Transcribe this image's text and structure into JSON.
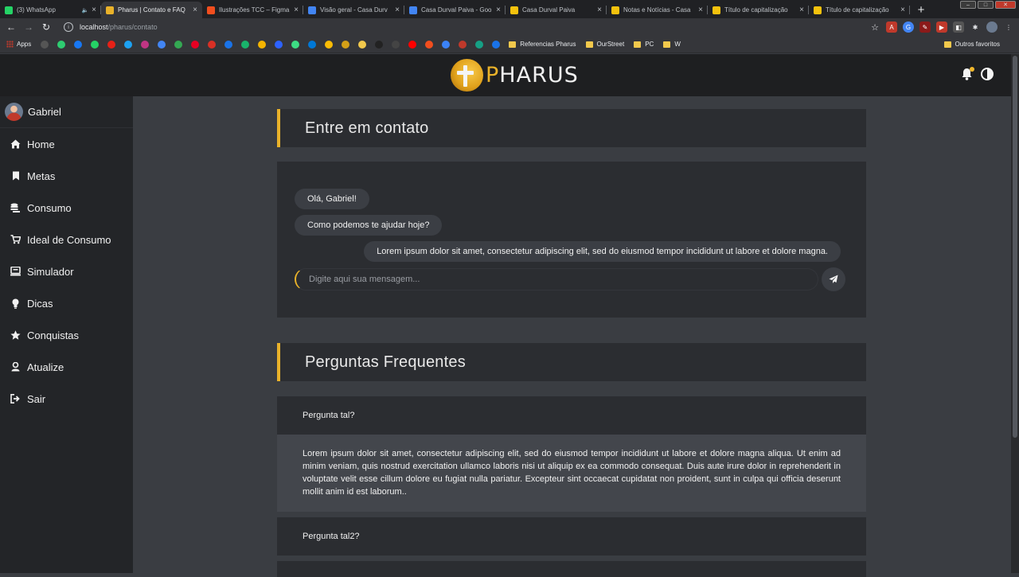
{
  "browser": {
    "tabs": [
      {
        "title": "(3) WhatsApp",
        "favicon_color": "#25d366",
        "favicon_glyph": "whatsapp-icon",
        "muted": true
      },
      {
        "title": "Pharus | Contato e FAQ",
        "favicon_color": "#e9b22a",
        "favicon_glyph": "pharus-icon",
        "active": true
      },
      {
        "title": "Ilustrações TCC – Figma",
        "favicon_color": "#f24e1e",
        "favicon_glyph": "figma-icon"
      },
      {
        "title": "Visão geral - Casa Durv",
        "favicon_color": "#4285f4",
        "favicon_glyph": "analytics-icon"
      },
      {
        "title": "Casa Durval Paiva - Goo",
        "favicon_color": "#4285f4",
        "favicon_glyph": "analytics-icon"
      },
      {
        "title": "Casa Durval Paiva",
        "favicon_color": "#f4c20d",
        "favicon_glyph": "site-icon"
      },
      {
        "title": "Notas e Notícias - Casa",
        "favicon_color": "#f4c20d",
        "favicon_glyph": "site-icon"
      },
      {
        "title": "Título de capitalização",
        "favicon_color": "#f4c20d",
        "favicon_glyph": "site-icon"
      },
      {
        "title": "Título de capitalização",
        "favicon_color": "#f4c20d",
        "favicon_glyph": "site-icon"
      }
    ],
    "url_host": "localhost",
    "url_path": "/pharus/contato",
    "bookmarks": {
      "apps_label": "Apps",
      "folders": [
        "Referencias Pharus",
        "OurStreet",
        "PC",
        "W"
      ],
      "other_label": "Outros favoritos",
      "icon_colors": [
        "#555",
        "#2ecc71",
        "#1877f2",
        "#25d366",
        "#e62117",
        "#1da1f2",
        "#c13584",
        "#4285f4",
        "#34a853",
        "#e60023",
        "#d93025",
        "#1a73e8",
        "#19b36b",
        "#f4b400",
        "#2d62ff",
        "#3ddc84",
        "#0078d7",
        "#fbbc05",
        "#d4a017",
        "#f2c94c",
        "#222",
        "#444",
        "#ff0000",
        "#f24e1e",
        "#3b82f6",
        "#c0392b",
        "#16a085",
        "#1a73e8"
      ]
    }
  },
  "app": {
    "brand_first": "P",
    "brand_rest": "HARUS",
    "user_name": "Gabriel",
    "menu": [
      {
        "label": "Home",
        "icon": "home-icon"
      },
      {
        "label": "Metas",
        "icon": "bookmark-icon"
      },
      {
        "label": "Consumo",
        "icon": "coins-icon"
      },
      {
        "label": "Ideal de Consumo",
        "icon": "cart-icon"
      },
      {
        "label": "Simulador",
        "icon": "simulator-icon"
      },
      {
        "label": "Dicas",
        "icon": "lightbulb-icon"
      },
      {
        "label": "Conquistas",
        "icon": "star-icon"
      },
      {
        "label": "Atualize",
        "icon": "user-update-icon"
      },
      {
        "label": "Sair",
        "icon": "sign-out-icon"
      }
    ],
    "accent": "#e9b22a"
  },
  "contact": {
    "title": "Entre em contato",
    "messages": [
      {
        "text": "Olá, Gabriel!",
        "from": "bot"
      },
      {
        "text": "Como podemos te ajudar hoje?",
        "from": "bot"
      },
      {
        "text": "Lorem ipsum dolor sit amet, consectetur adipiscing elit, sed do eiusmod tempor incididunt ut labore et dolore magna.",
        "from": "user"
      }
    ],
    "input_placeholder": "Digite aqui sua mensagem..."
  },
  "faq": {
    "title": "Perguntas Frequentes",
    "items": [
      {
        "question": "Pergunta tal?",
        "answer": "Lorem ipsum dolor sit amet, consectetur adipiscing elit, sed do eiusmod tempor incididunt ut labore et dolore magna aliqua. Ut enim ad minim veniam, quis nostrud exercitation ullamco laboris nisi ut aliquip ex ea commodo consequat. Duis aute irure dolor in reprehenderit in voluptate velit esse cillum dolore eu fugiat nulla pariatur. Excepteur sint occaecat cupidatat non proident, sunt in culpa qui officia deserunt mollit anim id est laborum..",
        "expanded": true
      },
      {
        "question": "Pergunta tal2?",
        "expanded": false
      }
    ]
  }
}
